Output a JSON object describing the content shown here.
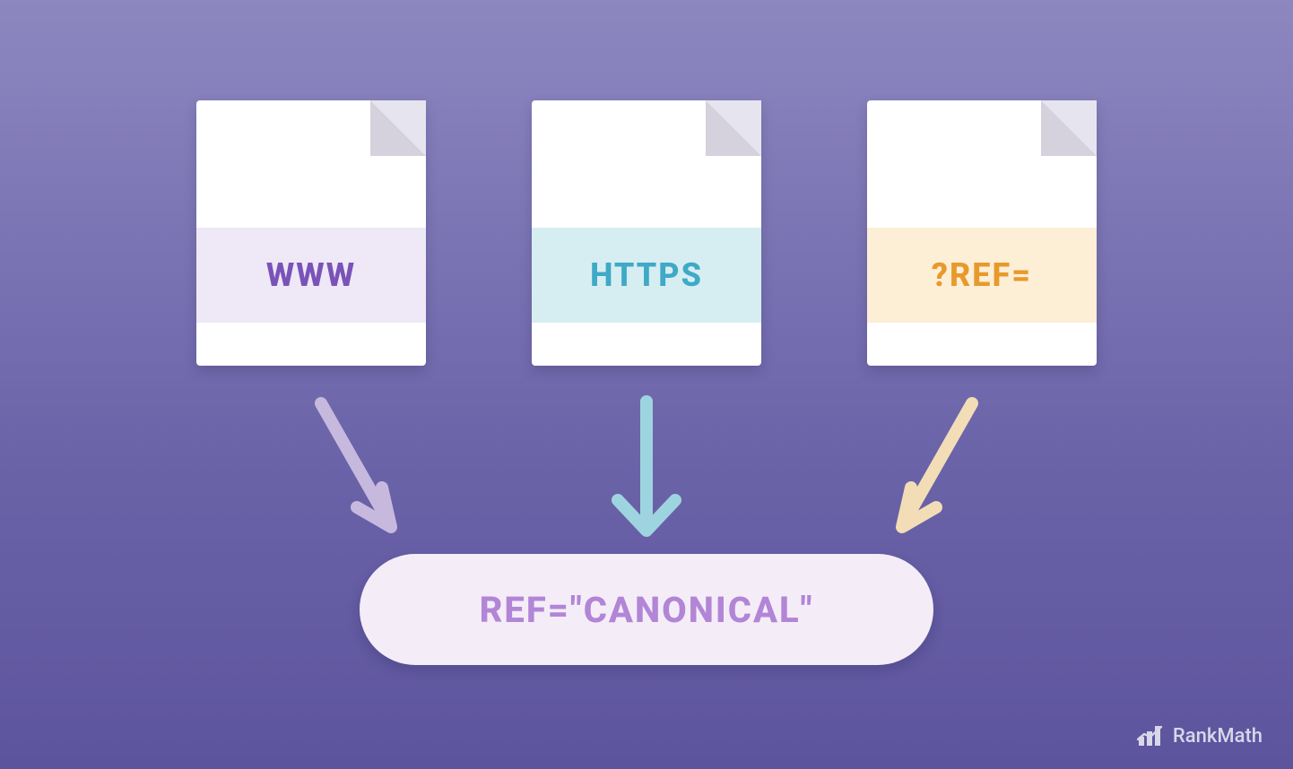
{
  "diagram": {
    "cards": [
      {
        "label": "WWW",
        "band_class": "band-www",
        "text_color": "#7a53b8",
        "band_color": "#efe8f6"
      },
      {
        "label": "HTTPS",
        "band_class": "band-https",
        "text_color": "#3fa9c7",
        "band_color": "#d6eef2"
      },
      {
        "label": "?REF=",
        "band_class": "band-ref",
        "text_color": "#e79a2b",
        "band_color": "#fdeed6"
      }
    ],
    "arrow_colors": {
      "left": "#c7b9dd",
      "center": "#9ed4df",
      "right": "#f3ddb7"
    },
    "target_label": "REF=\"CANONICAL\""
  },
  "branding": {
    "name": "RankMath"
  },
  "colors": {
    "bg_top": "#8d87c0",
    "bg_bottom": "#5d549e",
    "pill_bg": "#f4edf8",
    "pill_text": "#b285d6"
  }
}
